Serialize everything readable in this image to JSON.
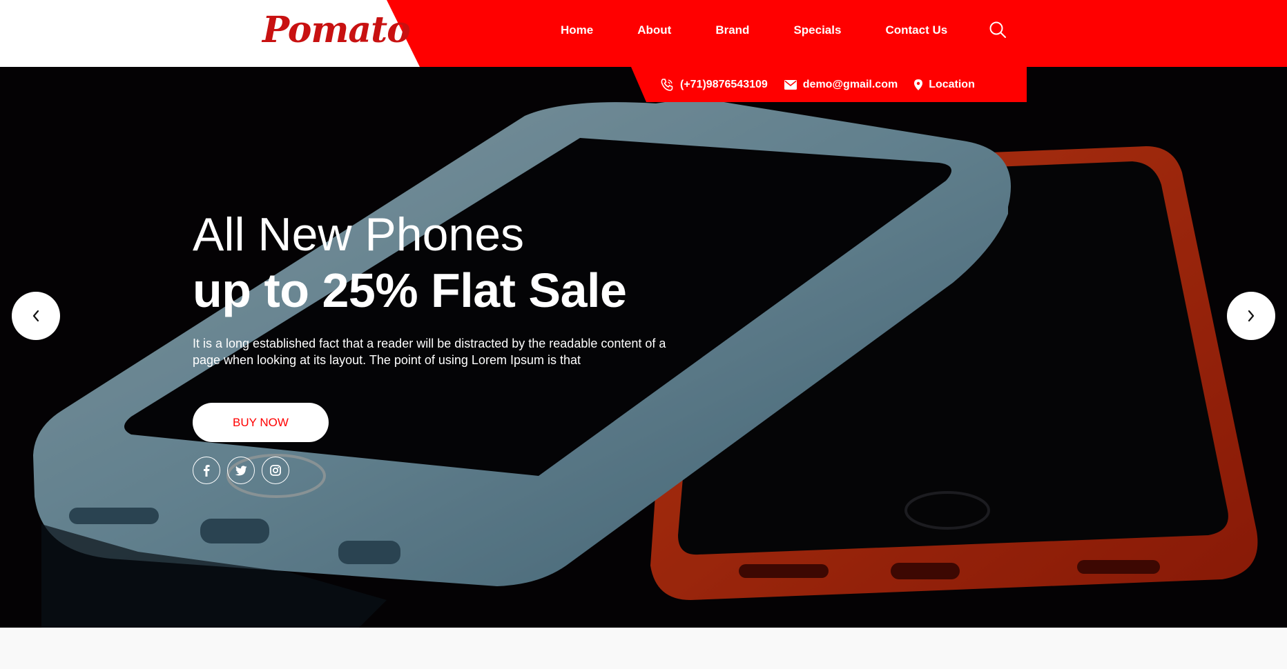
{
  "brand": {
    "logo_text": "Pomato",
    "accent_color": "#ff0000",
    "logo_color": "#c81111"
  },
  "nav": {
    "items": [
      {
        "label": "Home"
      },
      {
        "label": "About"
      },
      {
        "label": "Brand"
      },
      {
        "label": "Specials"
      },
      {
        "label": "Contact Us"
      }
    ],
    "search_icon": "search-icon"
  },
  "contact": {
    "phone": "(+71)9876543109",
    "email": "demo@gmail.com",
    "location": "Location",
    "icons": [
      "phone-icon",
      "envelope-icon",
      "map-pin-icon"
    ]
  },
  "hero": {
    "title": "All New Phones",
    "subtitle": "up to 25% Flat Sale",
    "description": "It is a long established fact that a reader will be distracted by the readable content of a page when looking at its layout. The point of using Lorem Ipsum is that",
    "button_label": "BUY NOW",
    "socials": [
      "facebook-icon",
      "twitter-icon",
      "instagram-icon"
    ]
  },
  "carousel": {
    "prev_icon": "chevron-left-icon",
    "next_icon": "chevron-right-icon"
  }
}
